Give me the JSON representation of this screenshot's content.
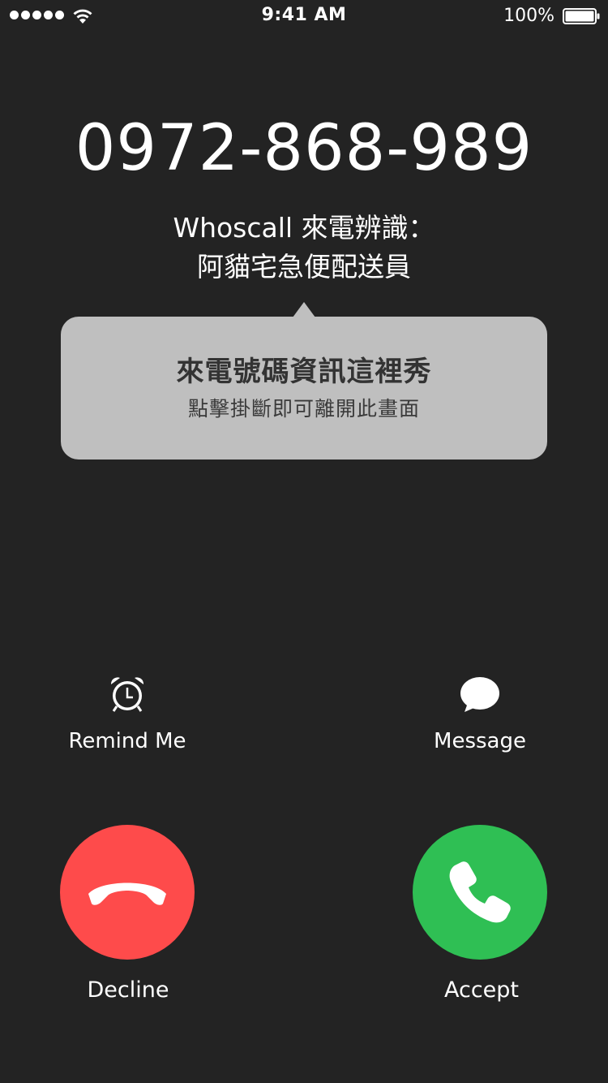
{
  "status_bar": {
    "time": "9:41 AM",
    "battery_percent": "100%",
    "signal_icon": "signal-dots-icon",
    "wifi_icon": "wifi-icon",
    "battery_icon": "battery-full-icon"
  },
  "call": {
    "number": "0972-868-989",
    "caller_id_line1": "Whoscall 來電辨識：",
    "caller_id_line2": "阿貓宅急便配送員"
  },
  "popup": {
    "title": "來電號碼資訊這裡秀",
    "subtitle": "點擊掛斷即可離開此畫面"
  },
  "actions": {
    "remind_me": {
      "label": "Remind Me",
      "icon": "alarm-clock-icon"
    },
    "message": {
      "label": "Message",
      "icon": "speech-bubble-icon"
    }
  },
  "buttons": {
    "decline": {
      "label": "Decline",
      "icon": "hang-up-phone-icon",
      "color": "#fe4b4b"
    },
    "accept": {
      "label": "Accept",
      "icon": "phone-icon",
      "color": "#2fbf54"
    }
  },
  "colors": {
    "background": "#232323",
    "popup_background": "#bfbfbf"
  }
}
